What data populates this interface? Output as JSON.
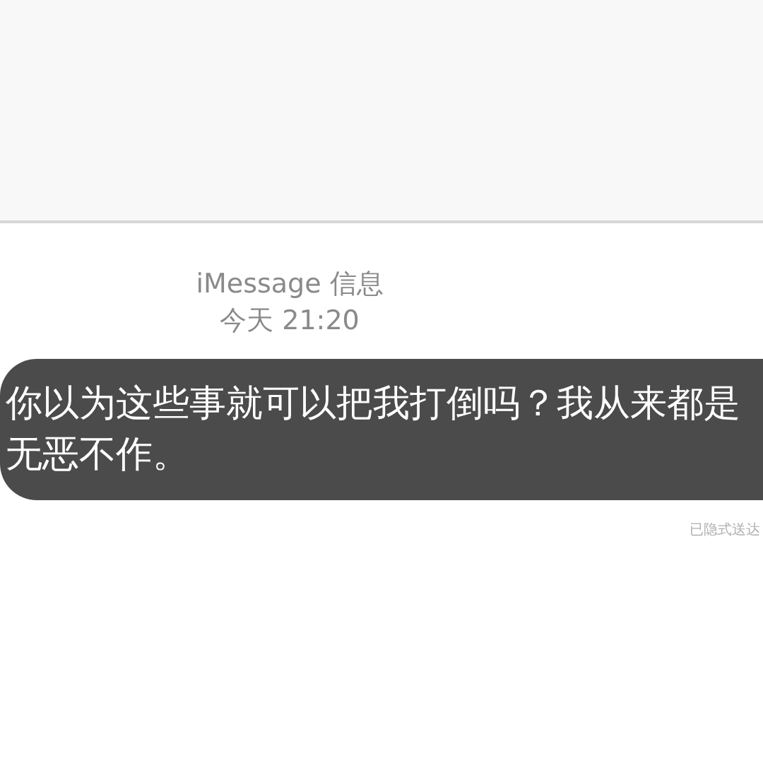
{
  "conversation_header": {
    "service": "iMessage 信息",
    "timestamp": "今天 21:20"
  },
  "messages": [
    {
      "text": "你以为这些事就可以把我打倒吗？我从来都是无恶不作。",
      "status": "已隐式送达"
    }
  ]
}
